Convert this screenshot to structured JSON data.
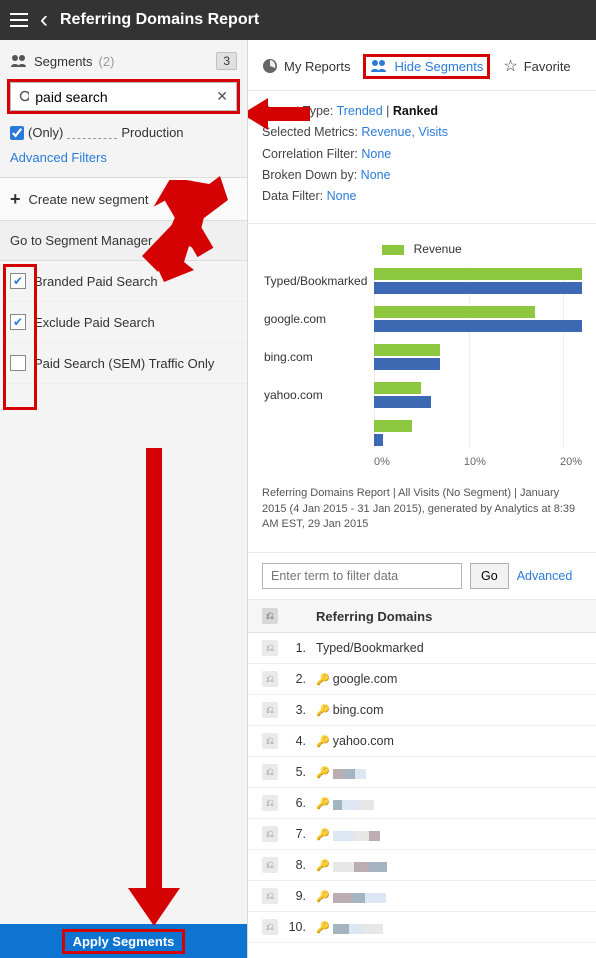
{
  "header": {
    "title": "Referring Domains Report"
  },
  "sidebar": {
    "title": "Segments",
    "count_label": "(2)",
    "badge": "3",
    "search_value": "paid search",
    "only_label": "(Only)",
    "only_suffix": "Production",
    "advanced_filters": "Advanced Filters",
    "create_segment": "Create new segment",
    "go_manager": "Go to Segment Manager",
    "items": [
      {
        "label": "Branded Paid Search",
        "checked": true
      },
      {
        "label": "Exclude Paid Search",
        "checked": true
      },
      {
        "label": "Paid Search (SEM) Traffic Only",
        "checked": false
      }
    ],
    "apply_label": "Apply Segments"
  },
  "tabs": {
    "my_reports": "My Reports",
    "hide_segments": "Hide Segments",
    "favorite": "Favorite"
  },
  "meta": {
    "report_type_label": "Report Type:",
    "report_type_link": "Trended",
    "report_type_sep": "|",
    "report_type_bold": "Ranked",
    "selected_metrics_label": "Selected Metrics:",
    "selected_metrics_value": "Revenue, Visits",
    "correlation_label": "Correlation Filter:",
    "correlation_value": "None",
    "broken_down_label": "Broken Down by:",
    "broken_down_value": "None",
    "data_filter_label": "Data Filter:",
    "data_filter_value": "None"
  },
  "chart_data": {
    "type": "bar",
    "legend": "Revenue",
    "xlabel_ticks": [
      "0%",
      "10%",
      "20%"
    ],
    "max_pct": 22,
    "rows": [
      {
        "label": "Typed/Bookmarked",
        "green": 22,
        "blue": 22
      },
      {
        "label": "google.com",
        "green": 17,
        "blue": 22
      },
      {
        "label": "bing.com",
        "green": 7,
        "blue": 7
      },
      {
        "label": "yahoo.com",
        "green": 5,
        "blue": 6
      },
      {
        "label": "",
        "green": 4,
        "blue": 1
      }
    ]
  },
  "caption": "Referring Domains Report | All Visits (No Segment) | January 2015 (4 Jan 2015 - 31 Jan 2015), generated by Analytics at  8:39 AM EST, 29 Jan 2015",
  "filter": {
    "placeholder": "Enter term to filter data",
    "go": "Go",
    "advanced": "Advanced"
  },
  "table": {
    "header": "Referring Domains",
    "rows": [
      {
        "n": "1.",
        "text": "Typed/Bookmarked",
        "key": false
      },
      {
        "n": "2.",
        "text": "google.com",
        "key": true
      },
      {
        "n": "3.",
        "text": "bing.com",
        "key": true
      },
      {
        "n": "4.",
        "text": "yahoo.com",
        "key": true
      },
      {
        "n": "5.",
        "text": "",
        "key": true,
        "blur": true
      },
      {
        "n": "6.",
        "text": "",
        "key": true,
        "blur": true
      },
      {
        "n": "7.",
        "text": "",
        "key": true,
        "blur": true
      },
      {
        "n": "8.",
        "text": "",
        "key": true,
        "blur": true
      },
      {
        "n": "9.",
        "text": "",
        "key": true,
        "blur": true
      },
      {
        "n": "10.",
        "text": "",
        "key": true,
        "blur": true
      }
    ]
  }
}
